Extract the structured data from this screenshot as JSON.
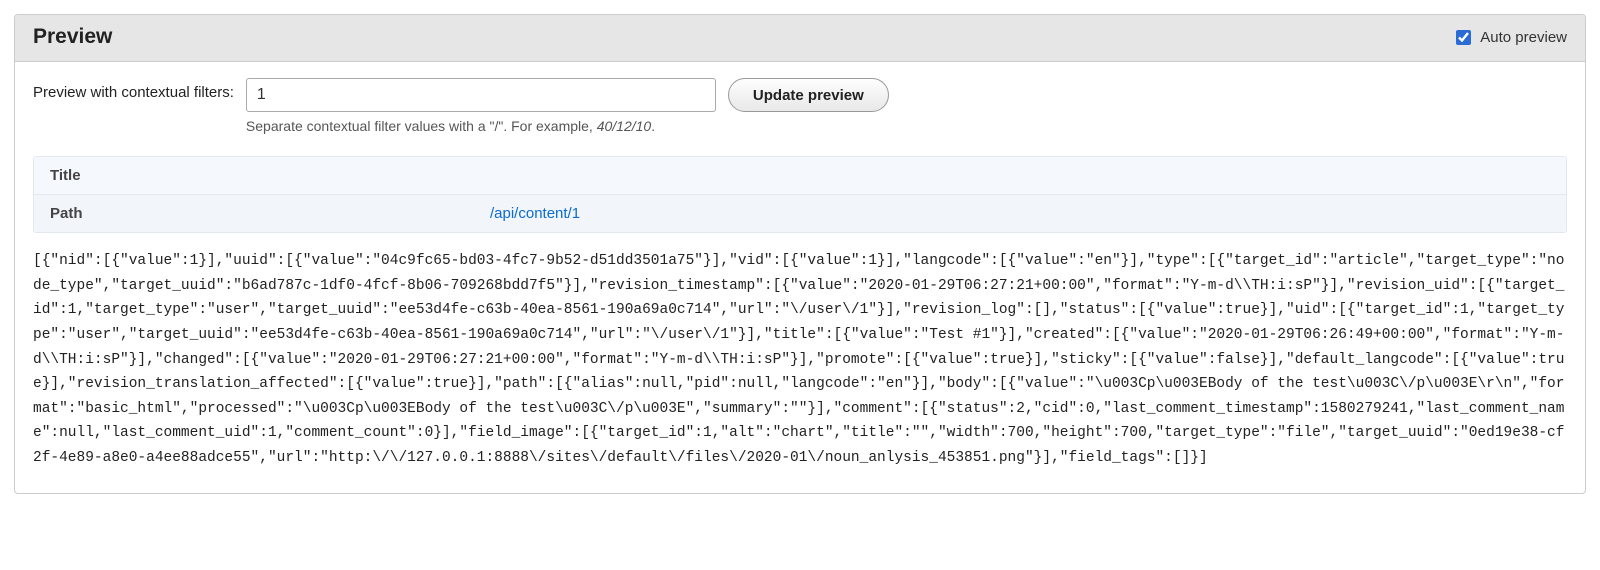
{
  "header": {
    "title": "Preview",
    "autoPreviewLabel": "Auto preview",
    "autoPreviewChecked": true
  },
  "filters": {
    "label": "Preview with contextual filters:",
    "value": "1",
    "helpPrefix": "Separate contextual filter values with a \"/\". For example, ",
    "helpExample": "40/12/10",
    "helpSuffix": ".",
    "submitLabel": "Update preview"
  },
  "meta": {
    "titleLabel": "Title",
    "titleValue": "",
    "pathLabel": "Path",
    "pathValue": "/api/content/1"
  },
  "jsonDump": "[{\"nid\":[{\"value\":1}],\"uuid\":[{\"value\":\"04c9fc65-bd03-4fc7-9b52-d51dd3501a75\"}],\"vid\":[{\"value\":1}],\"langcode\":[{\"value\":\"en\"}],\"type\":[{\"target_id\":\"article\",\"target_type\":\"node_type\",\"target_uuid\":\"b6ad787c-1df0-4fcf-8b06-709268bdd7f5\"}],\"revision_timestamp\":[{\"value\":\"2020-01-29T06:27:21+00:00\",\"format\":\"Y-m-d\\\\TH:i:sP\"}],\"revision_uid\":[{\"target_id\":1,\"target_type\":\"user\",\"target_uuid\":\"ee53d4fe-c63b-40ea-8561-190a69a0c714\",\"url\":\"\\/user\\/1\"}],\"revision_log\":[],\"status\":[{\"value\":true}],\"uid\":[{\"target_id\":1,\"target_type\":\"user\",\"target_uuid\":\"ee53d4fe-c63b-40ea-8561-190a69a0c714\",\"url\":\"\\/user\\/1\"}],\"title\":[{\"value\":\"Test #1\"}],\"created\":[{\"value\":\"2020-01-29T06:26:49+00:00\",\"format\":\"Y-m-d\\\\TH:i:sP\"}],\"changed\":[{\"value\":\"2020-01-29T06:27:21+00:00\",\"format\":\"Y-m-d\\\\TH:i:sP\"}],\"promote\":[{\"value\":true}],\"sticky\":[{\"value\":false}],\"default_langcode\":[{\"value\":true}],\"revision_translation_affected\":[{\"value\":true}],\"path\":[{\"alias\":null,\"pid\":null,\"langcode\":\"en\"}],\"body\":[{\"value\":\"\\u003Cp\\u003EBody of the test\\u003C\\/p\\u003E\\r\\n\",\"format\":\"basic_html\",\"processed\":\"\\u003Cp\\u003EBody of the test\\u003C\\/p\\u003E\",\"summary\":\"\"}],\"comment\":[{\"status\":2,\"cid\":0,\"last_comment_timestamp\":1580279241,\"last_comment_name\":null,\"last_comment_uid\":1,\"comment_count\":0}],\"field_image\":[{\"target_id\":1,\"alt\":\"chart\",\"title\":\"\",\"width\":700,\"height\":700,\"target_type\":\"file\",\"target_uuid\":\"0ed19e38-cf2f-4e89-a8e0-a4ee88adce55\",\"url\":\"http:\\/\\/127.0.0.1:8888\\/sites\\/default\\/files\\/2020-01\\/noun_anlysis_453851.png\"}],\"field_tags\":[]}]"
}
